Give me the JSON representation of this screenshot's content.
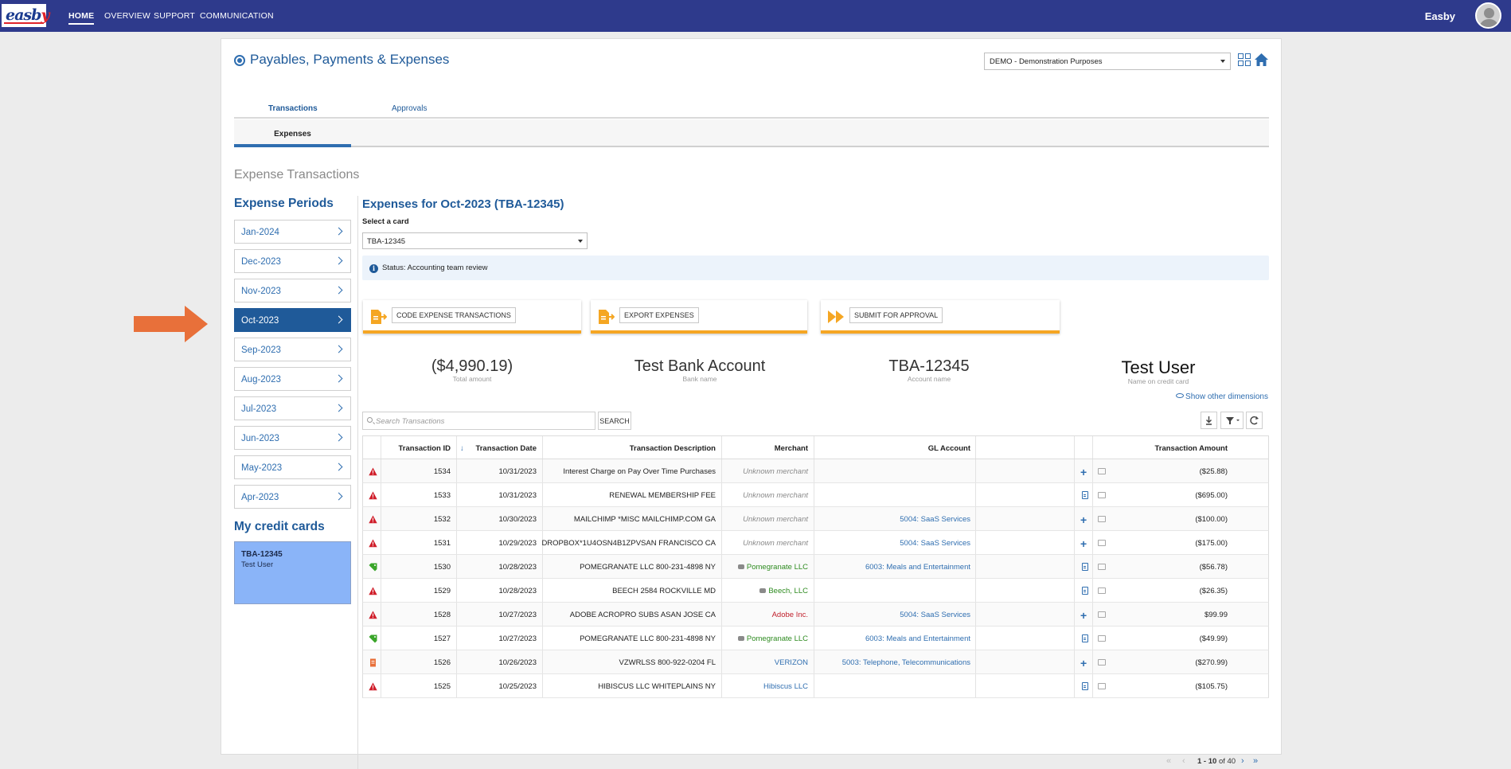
{
  "app": {
    "logo_text_main": "eas",
    "logo_text_y": "y",
    "logo_text_b": "b",
    "user": "Easby"
  },
  "nav": [
    {
      "label": "HOME",
      "active": true
    },
    {
      "label": "OVERVIEW",
      "active": false
    },
    {
      "label": "SUPPORT",
      "active": false
    },
    {
      "label": "COMMUNICATION",
      "active": false
    }
  ],
  "page": {
    "title": "Payables, Payments & Expenses",
    "company": "DEMO - Demonstration Purposes",
    "tabs": [
      "Transactions",
      "Approvals"
    ],
    "subtab": "Expenses",
    "section_title": "Expense Transactions"
  },
  "left": {
    "periods_heading": "Expense Periods",
    "periods": [
      "Jan-2024",
      "Dec-2023",
      "Nov-2023",
      "Oct-2023",
      "Sep-2023",
      "Aug-2023",
      "Jul-2023",
      "Jun-2023",
      "May-2023",
      "Apr-2023"
    ],
    "active_period": "Oct-2023",
    "cards_heading": "My credit cards",
    "card": {
      "number": "TBA-12345",
      "holder": "Test User"
    }
  },
  "main": {
    "title": "Expenses for Oct-2023 (TBA-12345)",
    "select_card_label": "Select a card",
    "selected_card": "TBA-12345",
    "status": "Status: Accounting team review",
    "actions": [
      "CODE EXPENSE TRANSACTIONS",
      "EXPORT EXPENSES",
      "SUBMIT FOR APPROVAL"
    ],
    "metrics": [
      {
        "value": "($4,990.19)",
        "label": "Total amount"
      },
      {
        "value": "Test Bank Account",
        "label": "Bank name"
      },
      {
        "value": "TBA-12345",
        "label": "Account name"
      },
      {
        "value": "Test User",
        "label": "Name on credit card"
      }
    ],
    "show_other_dimensions": "Show other dimensions",
    "search_placeholder": "Search Transactions",
    "search_button": "SEARCH",
    "sort_arrow": "↓"
  },
  "table": {
    "columns": [
      "Transaction ID",
      "Transaction Date",
      "Transaction Description",
      "Merchant",
      "GL Account",
      "Transaction Amount"
    ],
    "rows": [
      {
        "icon": "warning",
        "id": "1534",
        "date": "10/31/2023",
        "desc": "Interest Charge on Pay Over Time Purchases",
        "merchant": "Unknown merchant",
        "merchant_style": "unknown",
        "gl": "",
        "amount": "($25.88)",
        "action": "plus"
      },
      {
        "icon": "warning",
        "id": "1533",
        "date": "10/31/2023",
        "desc": "RENEWAL MEMBERSHIP FEE",
        "merchant": "Unknown merchant",
        "merchant_style": "unknown",
        "gl": "",
        "amount": "($695.00)",
        "action": "doc"
      },
      {
        "icon": "warning",
        "id": "1532",
        "date": "10/30/2023",
        "desc": "MAILCHIMP *MISC MAILCHIMP.COM GA",
        "merchant": "Unknown merchant",
        "merchant_style": "unknown",
        "gl": "5004: SaaS Services",
        "amount": "($100.00)",
        "action": "plus"
      },
      {
        "icon": "warning",
        "id": "1531",
        "date": "10/29/2023",
        "desc": "DROPBOX*1U4OSN4B1ZPVSAN FRANCISCO CA",
        "merchant": "Unknown merchant",
        "merchant_style": "unknown",
        "gl": "5004: SaaS Services",
        "amount": "($175.00)",
        "action": "plus"
      },
      {
        "icon": "tag",
        "id": "1530",
        "date": "10/28/2023",
        "desc": "POMEGRANATE LLC 800-231-4898 NY",
        "merchant": "Pomegranate LLC",
        "merchant_style": "green",
        "gl": "6003: Meals and Entertainment",
        "amount": "($56.78)",
        "action": "doc"
      },
      {
        "icon": "warning",
        "id": "1529",
        "date": "10/28/2023",
        "desc": "BEECH 2584 ROCKVILLE MD",
        "merchant": "Beech, LLC",
        "merchant_style": "green",
        "gl": "",
        "amount": "($26.35)",
        "action": "doc"
      },
      {
        "icon": "warning",
        "id": "1528",
        "date": "10/27/2023",
        "desc": "ADOBE ACROPRO SUBS ASAN JOSE CA",
        "merchant": "Adobe Inc.",
        "merchant_style": "red",
        "gl": "5004: SaaS Services",
        "amount": "$99.99",
        "action": "plus"
      },
      {
        "icon": "tag",
        "id": "1527",
        "date": "10/27/2023",
        "desc": "POMEGRANATE LLC 800-231-4898 NY",
        "merchant": "Pomegranate LLC",
        "merchant_style": "green",
        "gl": "6003: Meals and Entertainment",
        "amount": "($49.99)",
        "action": "doc"
      },
      {
        "icon": "receipt",
        "id": "1526",
        "date": "10/26/2023",
        "desc": "VZWRLSS 800-922-0204 FL",
        "merchant": "VERIZON",
        "merchant_style": "link",
        "gl": "5003: Telephone, Telecommunications",
        "amount": "($270.99)",
        "action": "plus"
      },
      {
        "icon": "warning",
        "id": "1525",
        "date": "10/25/2023",
        "desc": "HIBISCUS LLC WHITEPLAINS NY",
        "merchant": "Hibiscus LLC",
        "merchant_style": "link",
        "gl": "",
        "amount": "($105.75)",
        "action": "doc"
      }
    ]
  },
  "pager": {
    "range": "1 - 10",
    "of_label": "of",
    "total": "40"
  },
  "colors": {
    "nav_bg": "#2e3a8c",
    "accent_blue": "#1f5a99",
    "orange": "#f5a623",
    "arrow": "#e8703a",
    "card_bg": "#8ab4f8"
  }
}
